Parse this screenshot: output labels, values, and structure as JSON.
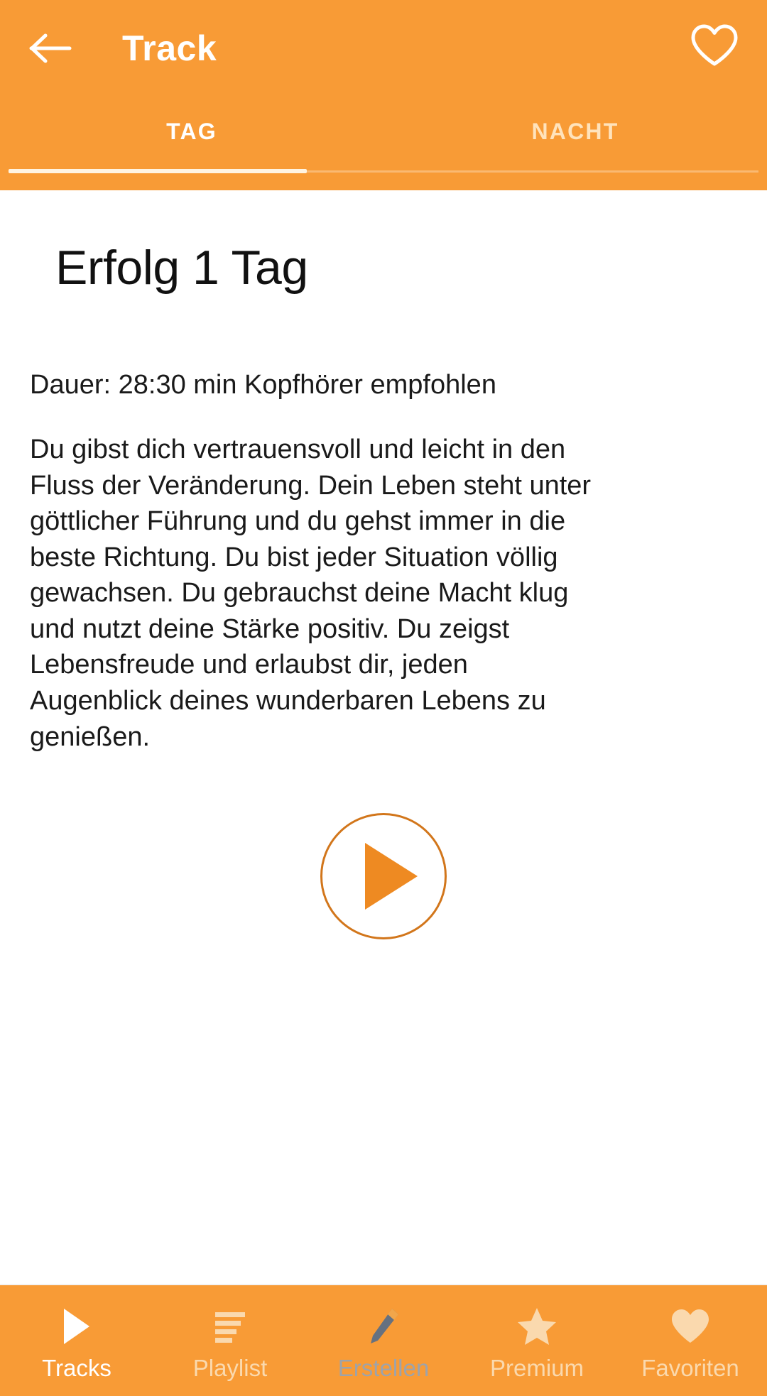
{
  "theme": {
    "header_bg": "#F89B36",
    "accent": "#EE8A22",
    "play_border": "#D2761B",
    "content_bg": "#FFFFFF",
    "active_text": "#FFFFFF",
    "inactive_text": "#FFE3BC",
    "body_text": "#1A1A1A"
  },
  "header": {
    "back_icon": "arrow-left-icon",
    "title": "Track",
    "favorite_icon": "heart-outline-icon"
  },
  "tabs": [
    {
      "label": "TAG",
      "active": true
    },
    {
      "label": "NACHT",
      "active": false
    }
  ],
  "main": {
    "track_title": "Erfolg 1 Tag",
    "duration": "Dauer: 28:30 min Kopfhörer empfohlen",
    "description": "Du gibst dich vertrauensvoll und leicht in den Fluss der Veränderung. Dein Leben steht unter göttlicher Führung und du gehst immer in die beste Richtung. Du bist jeder Situation völlig gewachsen. Du gebrauchst deine Macht klug und nutzt deine Stärke positiv. Du zeigst Lebensfreude und erlaubst dir, jeden Augenblick deines wunderbaren Lebens zu genießen.",
    "play_button_icon": "play-icon"
  },
  "bottom_nav": [
    {
      "label": "Tracks",
      "icon": "play-icon",
      "active": true
    },
    {
      "label": "Playlist",
      "icon": "list-icon",
      "active": false
    },
    {
      "label": "Erstellen",
      "icon": "pencil-icon",
      "active": false
    },
    {
      "label": "Premium",
      "icon": "star-icon",
      "active": false
    },
    {
      "label": "Favoriten",
      "icon": "heart-filled-icon",
      "active": false
    }
  ]
}
